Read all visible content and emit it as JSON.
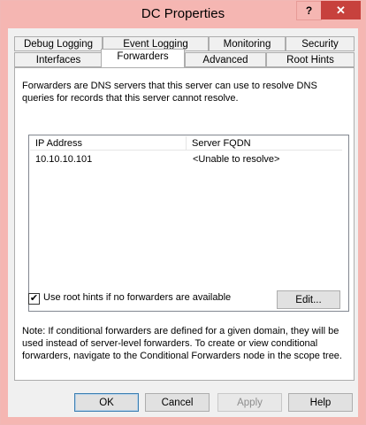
{
  "window": {
    "title": "DC Properties",
    "help_glyph": "?",
    "close_glyph": "✕"
  },
  "tabs": {
    "row1": [
      "Debug Logging",
      "Event Logging",
      "Monitoring",
      "Security"
    ],
    "row2": [
      "Interfaces",
      "Forwarders",
      "Advanced",
      "Root Hints"
    ],
    "active": "Forwarders"
  },
  "forwarders": {
    "description": "Forwarders are DNS servers that this server can use to resolve DNS queries for records that this server cannot resolve.",
    "columns": [
      "IP Address",
      "Server FQDN"
    ],
    "rows": [
      {
        "ip": "10.10.10.101",
        "fqdn": "<Unable to resolve>"
      }
    ],
    "use_root_hints_label": "Use root hints if no forwarders are available",
    "use_root_hints_checked": true,
    "check_glyph": "✔",
    "edit_label": "Edit...",
    "note": "Note: If conditional forwarders are defined for a given domain, they will be used instead of server-level forwarders.  To create or view conditional forwarders, navigate to the Conditional Forwarders node in the scope tree."
  },
  "buttons": {
    "ok": "OK",
    "cancel": "Cancel",
    "apply": "Apply",
    "help": "Help"
  }
}
